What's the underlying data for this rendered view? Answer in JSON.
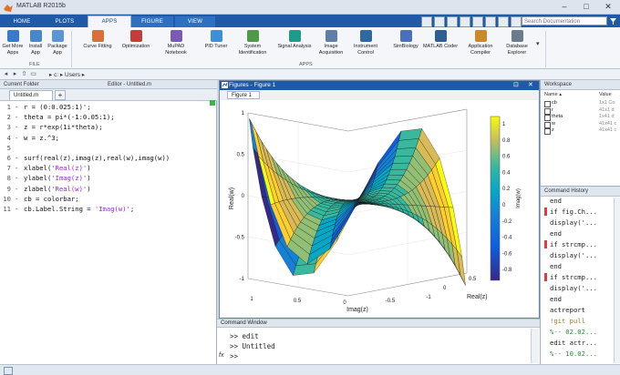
{
  "window": {
    "title": "MATLAB R2015b",
    "minimize": "–",
    "maximize": "□",
    "close": "✕"
  },
  "ribbon_tabs": [
    "HOME",
    "PLOTS",
    "APPS",
    "FIGURE",
    "VIEW"
  ],
  "active_tab": "APPS",
  "search": {
    "placeholder": "Search Documentation"
  },
  "ribbon": {
    "file_buttons": [
      {
        "label1": "Get More",
        "label2": "Apps"
      },
      {
        "label1": "Install",
        "label2": "App"
      },
      {
        "label1": "Package",
        "label2": "App"
      }
    ],
    "file_section": "FILE",
    "apps": [
      {
        "label1": "Curve Fitting",
        "label2": ""
      },
      {
        "label1": "Optimization",
        "label2": ""
      },
      {
        "label1": "MuPAD",
        "label2": "Notebook"
      },
      {
        "label1": "PID Tuner",
        "label2": ""
      },
      {
        "label1": "System",
        "label2": "Identification"
      },
      {
        "label1": "Signal Analysis",
        "label2": ""
      },
      {
        "label1": "Image",
        "label2": "Acquisition"
      },
      {
        "label1": "Instrument",
        "label2": "Control"
      },
      {
        "label1": "SimBiology",
        "label2": ""
      },
      {
        "label1": "MATLAB Coder",
        "label2": ""
      },
      {
        "label1": "Application",
        "label2": "Compiler"
      },
      {
        "label1": "Database",
        "label2": "Explorer"
      }
    ],
    "apps_section": "APPS"
  },
  "address": {
    "path": "▸ c: ▸ Users ▸"
  },
  "panels": {
    "current_folder": "Current Folder",
    "editor": "Editor - Untitled.m",
    "figure": "Figures - Figure 1",
    "figure_tab": "Figure 1",
    "command_window": "Command Window",
    "workspace": "Workspace",
    "command_history": "Command History"
  },
  "editor": {
    "tab": "Untitled.m",
    "plus": "+",
    "lines": [
      {
        "n": "1",
        "pre": "r = (0:0.025:1)';",
        "str": "",
        "post": ""
      },
      {
        "n": "2",
        "pre": "theta = pi*(-1:0.05:1);",
        "str": "",
        "post": ""
      },
      {
        "n": "3",
        "pre": "z = r*exp(1i*theta);",
        "str": "",
        "post": ""
      },
      {
        "n": "4",
        "pre": "w = z.^3;",
        "str": "",
        "post": ""
      },
      {
        "n": "5",
        "pre": "",
        "str": "",
        "post": ""
      },
      {
        "n": "6",
        "pre": "surf(real(z),imag(z),real(w),imag(w))",
        "str": "",
        "post": ""
      },
      {
        "n": "7",
        "pre": "xlabel(",
        "str": "'Real(z)'",
        "post": ")"
      },
      {
        "n": "8",
        "pre": "ylabel(",
        "str": "'Imag(z)'",
        "post": ")"
      },
      {
        "n": "9",
        "pre": "zlabel(",
        "str": "'Real(w)'",
        "post": ")"
      },
      {
        "n": "10",
        "pre": "cb = colorbar;",
        "str": "",
        "post": ""
      },
      {
        "n": "11",
        "pre": "cb.Label.String = ",
        "str": "'Imag(w)'",
        "post": ";"
      }
    ]
  },
  "plot": {
    "zlabel": "Real(w)",
    "xlabel": "Real(z)",
    "ylabel": "Imag(z)",
    "z_ticks": [
      "1",
      "0.5",
      "0",
      "-0.5",
      "-1"
    ],
    "y_ticks": [
      "1",
      "0.5",
      "0",
      "-0.5",
      "-1"
    ],
    "x_ticks": [
      "0",
      "0.5",
      "-1",
      "-0.5"
    ],
    "colorbar_label": "Imag(w)",
    "colorbar_ticks": [
      "1",
      "0.8",
      "0.6",
      "0.4",
      "0.2",
      "0",
      "-0.2",
      "-0.4",
      "-0.6",
      "-0.8"
    ]
  },
  "command_window": {
    "lines": [
      ">> edit",
      ">> Untitled",
      ">>"
    ],
    "fx": "fx"
  },
  "workspace": {
    "header_name": "Name ▴",
    "header_value": "Value",
    "vars": [
      {
        "name": "cb",
        "value": "1x1 Co"
      },
      {
        "name": "r",
        "value": "41x1 d"
      },
      {
        "name": "theta",
        "value": "1x41 d"
      },
      {
        "name": "w",
        "value": "41x41 c"
      },
      {
        "name": "z",
        "value": "41x41 c"
      }
    ]
  },
  "history": {
    "lines": [
      "end",
      "if fig.Ch...",
      "display('...",
      "end",
      "if strcmp...",
      "display('...",
      "end",
      "if strcmp...",
      "display('...",
      "end",
      "actreport",
      "!git pull",
      "%-- 02.02...",
      "edit actr...",
      "%-- 10.02..."
    ]
  },
  "colors": {
    "accent": "#1e5aa8",
    "string": "#a020f0",
    "history_marker": "#e03a3a"
  }
}
